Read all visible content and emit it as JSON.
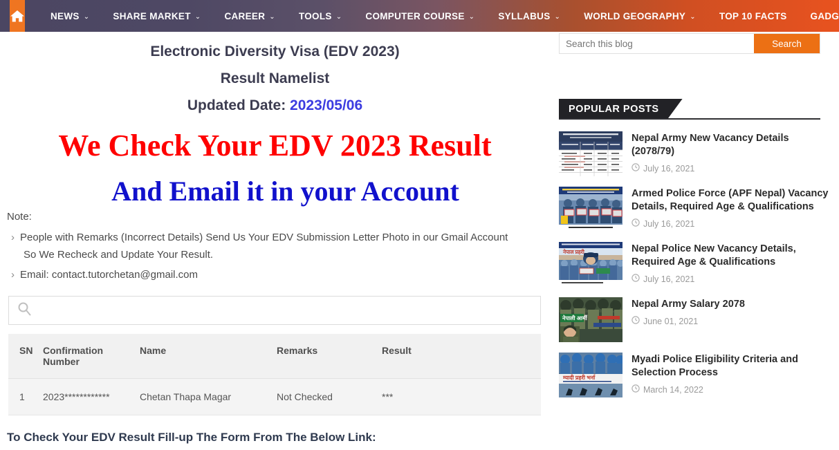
{
  "navbar": {
    "home_icon": "home-icon",
    "search_icon": "search-icon",
    "items": [
      {
        "label": "NEWS",
        "caret": true
      },
      {
        "label": "SHARE MARKET",
        "caret": true
      },
      {
        "label": "CAREER",
        "caret": true
      },
      {
        "label": "TOOLS",
        "caret": true
      },
      {
        "label": "COMPUTER COURSE",
        "caret": true
      },
      {
        "label": "SYLLABUS",
        "caret": true
      },
      {
        "label": "WORLD GEOGRAPHY",
        "caret": true
      },
      {
        "label": "TOP 10 FACTS",
        "caret": false
      },
      {
        "label": "GADGETS",
        "caret": true
      }
    ]
  },
  "main": {
    "title_line1": "Electronic Diversity Visa (EDV 2023)",
    "title_line2": "Result Namelist",
    "title_line3_prefix": "Updated Date: ",
    "updated_date": "2023/05/06",
    "headline_red": "We Check Your EDV 2023 Result",
    "headline_blue": "And Email it in your Account",
    "note_label": "Note:",
    "notes": [
      "People with Remarks (Incorrect Details) Send Us Your EDV Submission Letter Photo in our Gmail Account So We Recheck and Update Your Result.",
      "Email: contact.tutorchetan@gmail.com"
    ],
    "table_search": {
      "value": "",
      "placeholder": "",
      "icon": "search-icon"
    },
    "table": {
      "columns": [
        "SN",
        "Confirmation Number",
        "Name",
        "Remarks",
        "Result"
      ],
      "rows": [
        {
          "sn": "1",
          "confirmation_number": "2023************",
          "name": "Chetan Thapa Magar",
          "remarks": "Not Checked",
          "result": "***"
        }
      ]
    },
    "bottom_line": "To Check Your EDV Result Fill-up The Form From The Below Link:"
  },
  "sidebar": {
    "blog_search": {
      "value": "",
      "placeholder": "Search this blog",
      "button_label": "Search"
    },
    "popular_posts": {
      "heading": "POPULAR POSTS",
      "items": [
        {
          "title": "Nepal Army New Vacancy Details (2078/79)",
          "date": "July 16, 2021",
          "thumb_kind": "table"
        },
        {
          "title": "Armed Police Force (APF Nepal) Vacancy Details, Required Age & Qualifications",
          "date": "July 16, 2021",
          "thumb_kind": "apf"
        },
        {
          "title": "Nepal Police New Vacancy Details, Required Age & Qualifications",
          "date": "July 16, 2021",
          "thumb_kind": "police"
        },
        {
          "title": "Nepal Army Salary 2078",
          "date": "June 01, 2021",
          "thumb_kind": "army"
        },
        {
          "title": "Myadi Police Eligibility Criteria and Selection Process",
          "date": "March 14, 2022",
          "thumb_kind": "myadi"
        }
      ]
    }
  },
  "colors": {
    "nav_left": "#4b4662",
    "nav_right": "#e8521f",
    "home_btn": "#ef7521",
    "accent_orange": "#ec7014",
    "headline_red": "#ff0000",
    "headline_blue": "#1111cc",
    "date_blue": "#3c3ce0",
    "widget_dark": "#222226"
  }
}
